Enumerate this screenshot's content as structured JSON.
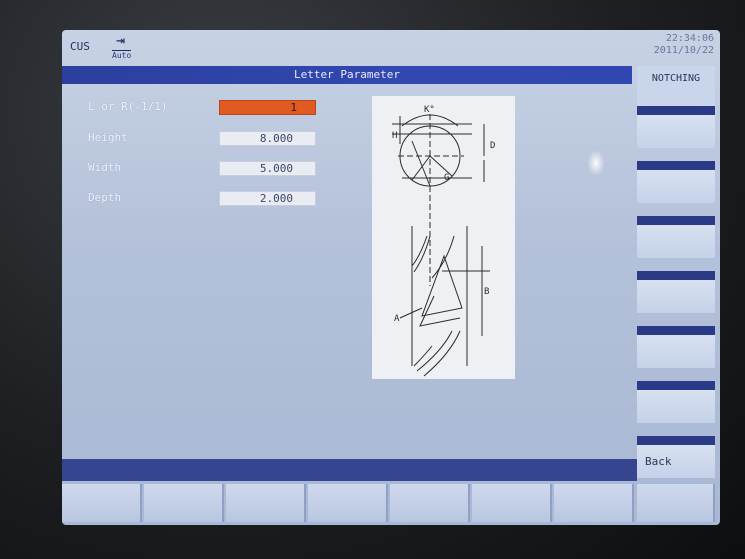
{
  "status": {
    "mode": "CUS",
    "auto_label": "Auto",
    "time": "22:34:06",
    "date": "2011/10/22"
  },
  "title": "Letter Parameter",
  "params": [
    {
      "label": "L or R(-1/1)",
      "value": "1"
    },
    {
      "label": "Height",
      "value": "8.000"
    },
    {
      "label": "Width",
      "value": "5.000"
    },
    {
      "label": "Depth",
      "value": "2.000"
    }
  ],
  "softkeys_right": {
    "top_label": "NOTCHING",
    "back_label": "Back"
  },
  "colors": {
    "title_bar": "#3147b0",
    "active_field": "#e05a22",
    "screen_bg": "#b8c4db"
  },
  "icons": {
    "auto_mode": "arrow-right-to-bar-icon"
  }
}
